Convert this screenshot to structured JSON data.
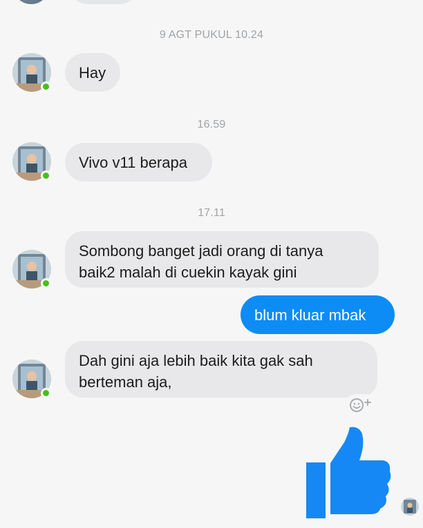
{
  "messages": {
    "timestamps": [
      "9 AGT PUKUL 10.24",
      "16.59",
      "17.11"
    ],
    "incoming": [
      {
        "text": "Hay"
      },
      {
        "text": "Vivo v11 berapa"
      },
      {
        "text": "Sombong banget jadi orang di tanya\nbaik2 malah di cuekin kayak gini"
      },
      {
        "text": "Dah gini aja lebih baik kita gak sah\nberteman aja,"
      }
    ],
    "outgoing": [
      {
        "text": "blum kluar mbak"
      }
    ]
  },
  "icons": {
    "reaction": "smiley-plus-icon",
    "like": "thumbs-up-icon",
    "presence": "online-dot-icon",
    "seen": "seen-avatar-icon"
  },
  "colors": {
    "outgoing_bubble": "#0d8cf5",
    "incoming_bubble": "#e8e8ea",
    "like_icon": "#1688f5",
    "presence_dot": "#42c21a",
    "timestamp": "#9fa3a8"
  }
}
